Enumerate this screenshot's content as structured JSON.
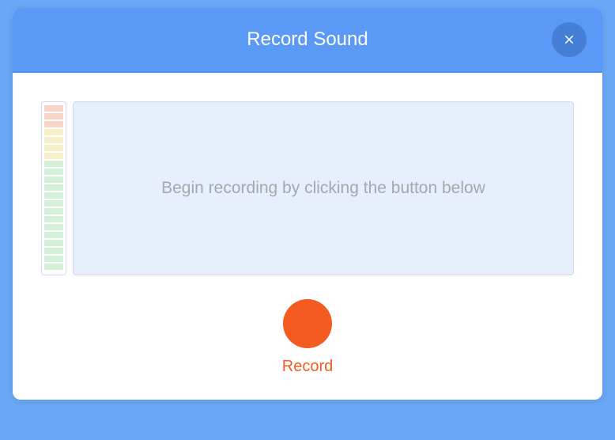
{
  "modal": {
    "title": "Record Sound",
    "hint": "Begin recording by clicking the button below",
    "record_label": "Record"
  },
  "colors": {
    "header_bg": "#5b99f7",
    "accent": "#f35b20",
    "hint_text": "#a6a8ab"
  }
}
